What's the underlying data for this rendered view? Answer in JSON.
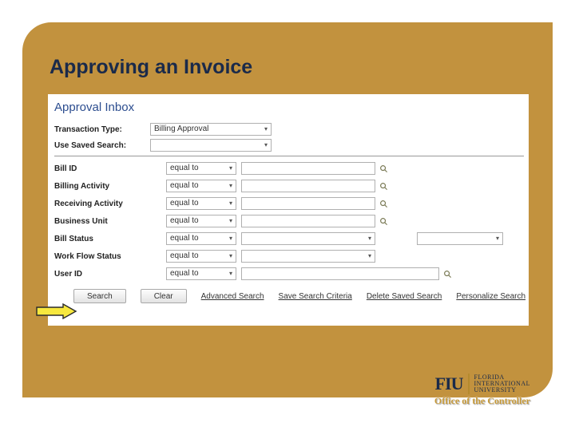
{
  "slide": {
    "title": "Approving an Invoice"
  },
  "app": {
    "heading": "Approval Inbox",
    "top": {
      "transactionType": {
        "label": "Transaction Type:",
        "value": "Billing Approval"
      },
      "savedSearch": {
        "label": "Use Saved Search:",
        "value": ""
      }
    },
    "criteria": {
      "billId": {
        "label": "Bill ID",
        "op": "equal to"
      },
      "billingActivity": {
        "label": "Billing Activity",
        "op": "equal to"
      },
      "receivingActivity": {
        "label": "Receiving Activity",
        "op": "equal to"
      },
      "businessUnit": {
        "label": "Business Unit",
        "op": "equal to"
      },
      "billStatus": {
        "label": "Bill Status",
        "op": "equal to"
      },
      "workflowStatus": {
        "label": "Work Flow Status",
        "op": "equal to"
      },
      "userId": {
        "label": "User ID",
        "op": "equal to"
      }
    },
    "buttons": {
      "search": "Search",
      "clear": "Clear",
      "advanced": "Advanced Search",
      "saveCriteria": "Save Search Criteria",
      "deleteSaved": "Delete Saved Search",
      "personalize": "Personalize Search"
    }
  },
  "branding": {
    "mark": "FIU",
    "line1": "FLORIDA",
    "line2": "INTERNATIONAL",
    "line3": "UNIVERSITY",
    "office": "Office of the Controller"
  }
}
